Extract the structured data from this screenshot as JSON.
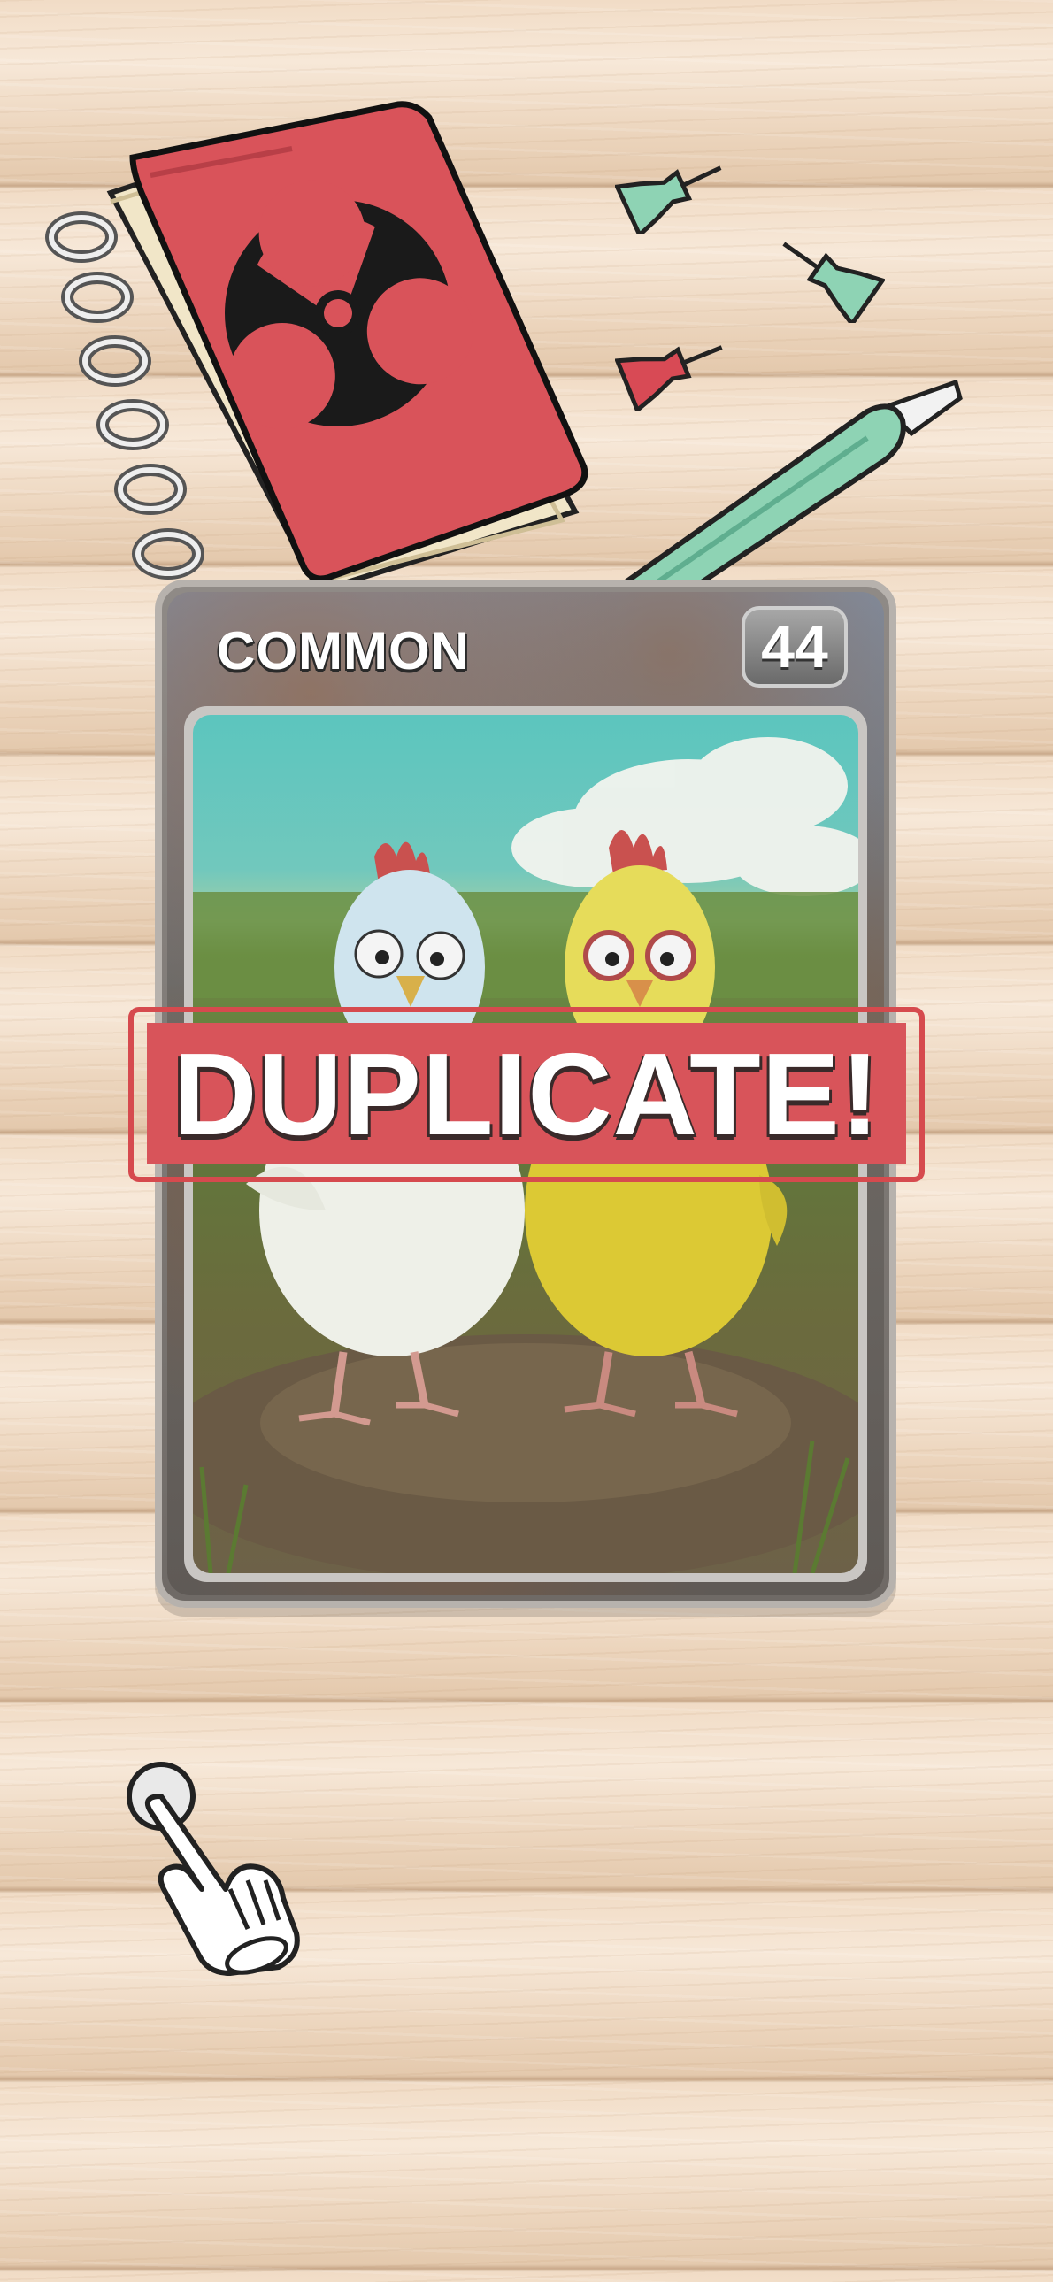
{
  "card": {
    "rarity": "COMMON",
    "number": "44",
    "artwork": "two-cartoon-chickens-in-field"
  },
  "banner": {
    "text": "DUPLICATE!"
  },
  "decor": {
    "notebook": "biohazard-notebook-icon",
    "pins": [
      "green-pushpin-icon",
      "green-pushpin-icon",
      "red-pushpin-icon"
    ],
    "blade": "utility-knife-icon",
    "hint": "tap-hand-icon"
  },
  "colors": {
    "notebook_red": "#d9535a",
    "banner_red": "#d8545a",
    "pin_green": "#8ed3b4",
    "pin_red": "#d84a55"
  }
}
